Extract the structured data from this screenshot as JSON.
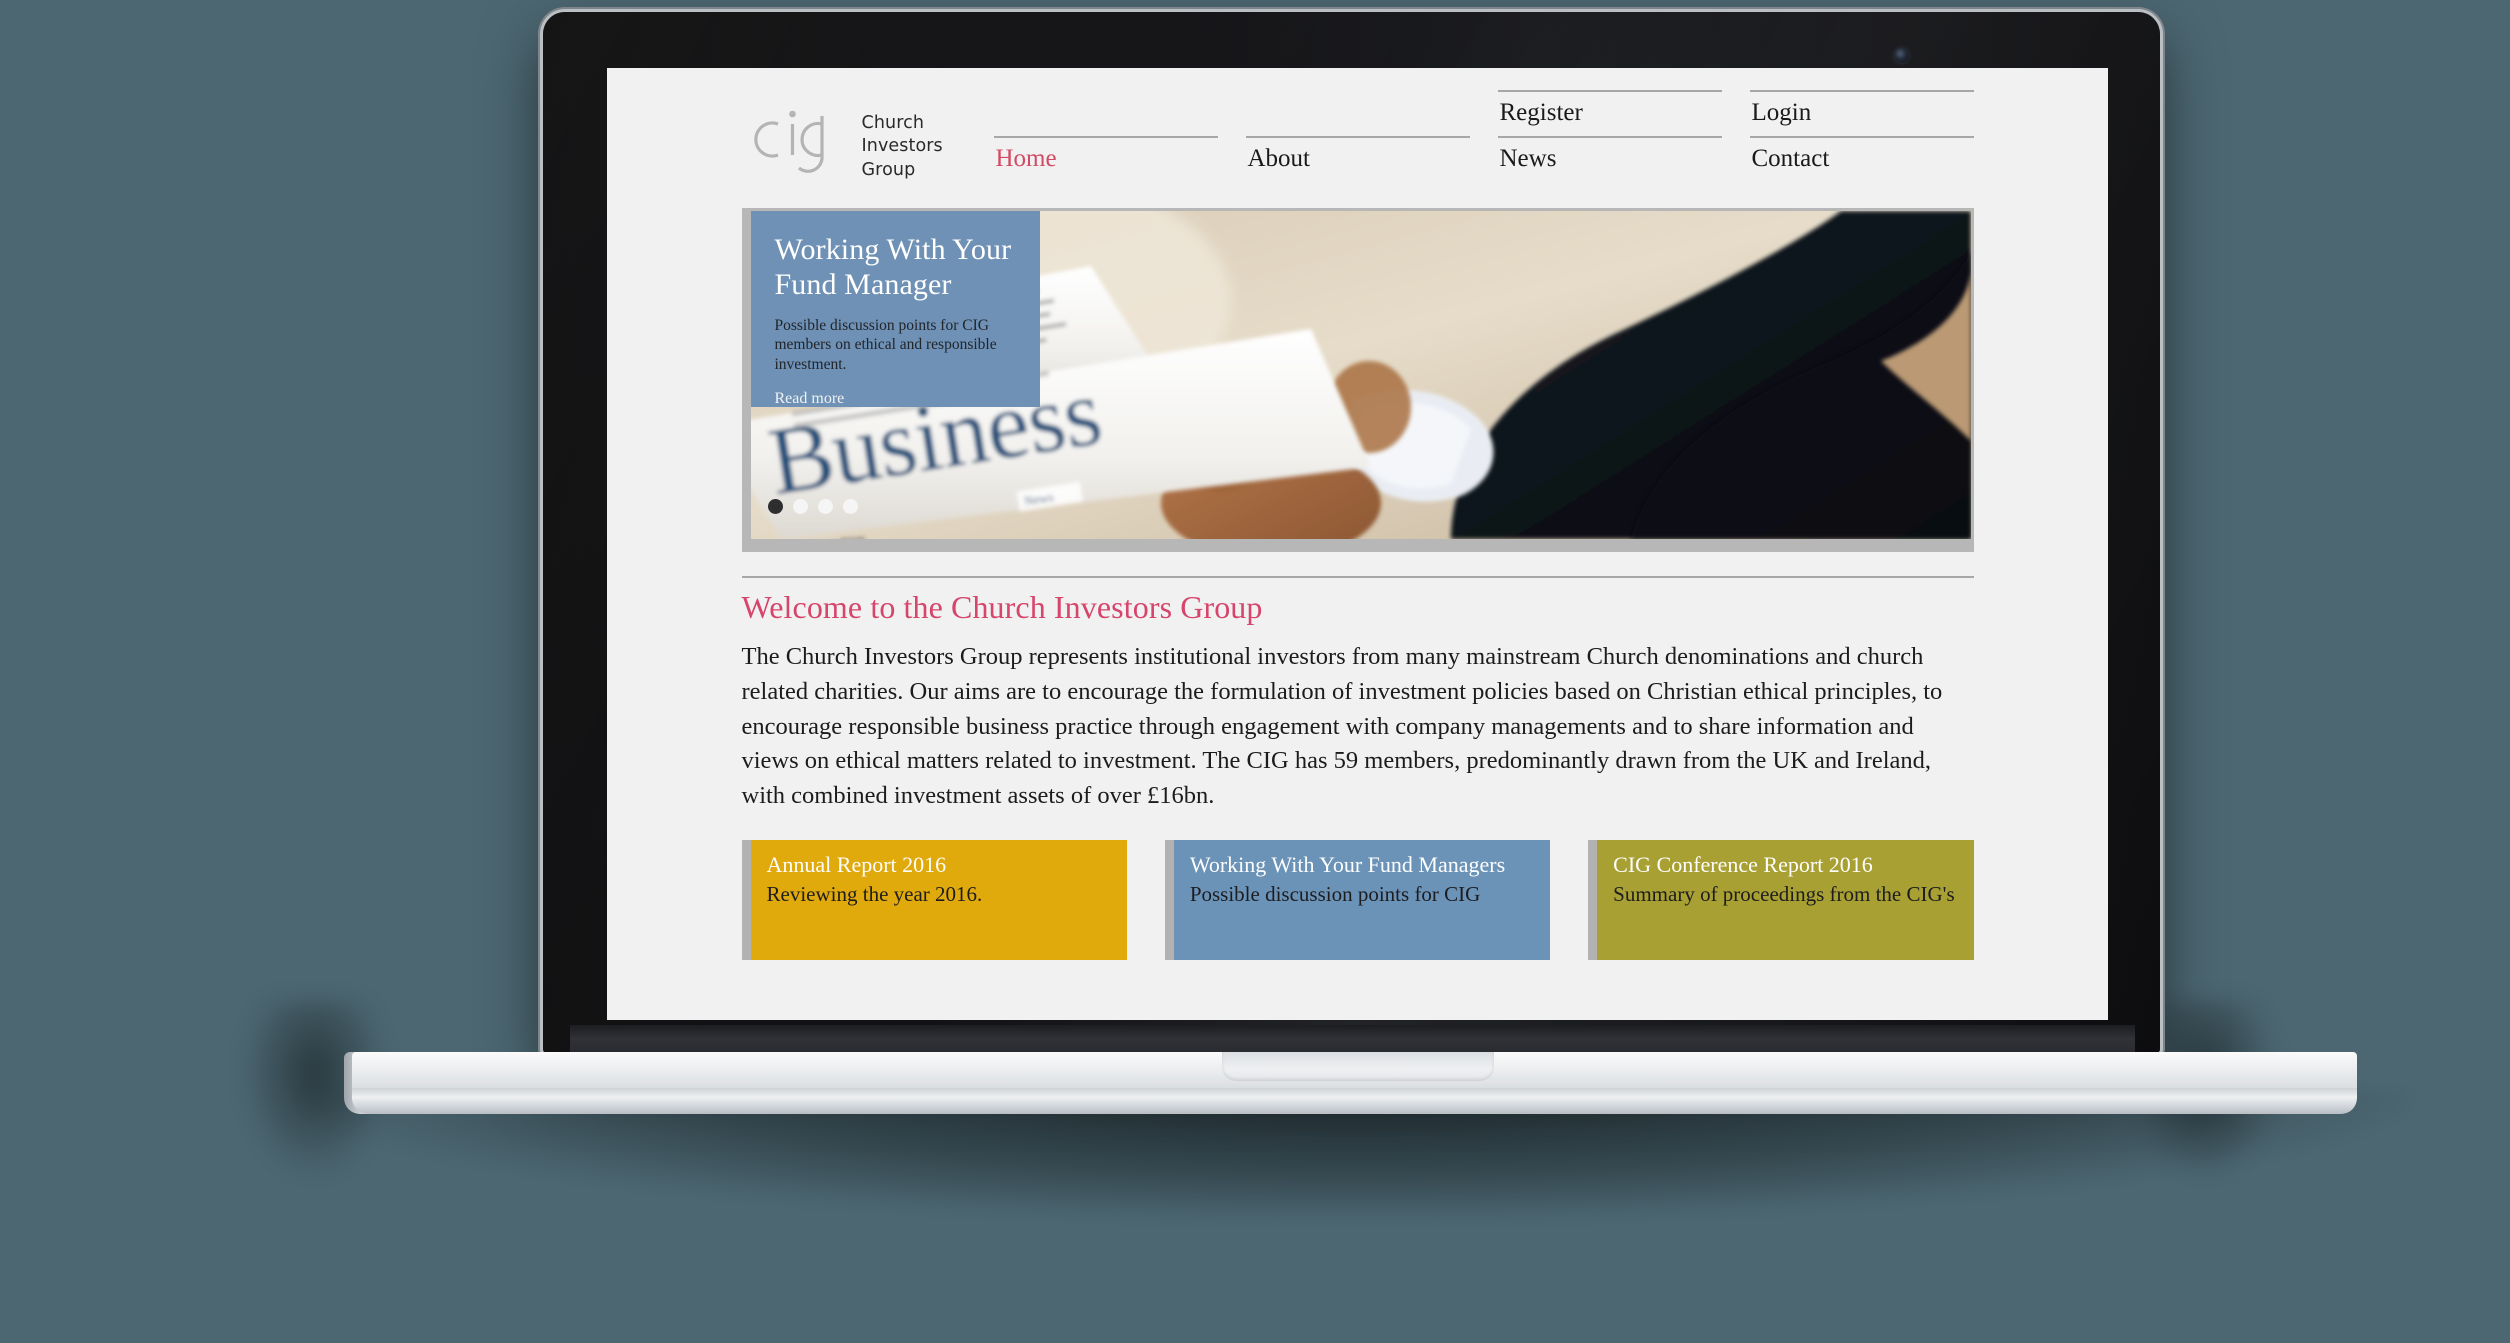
{
  "device": {
    "kind": "laptop-mockup",
    "backdrop_color": "#4c6772"
  },
  "site": {
    "brand": {
      "logo_text": "cig",
      "name_line1": "Church",
      "name_line2": "Investors",
      "name_line3": "Group"
    },
    "nav": {
      "top_row": [
        {
          "label": "",
          "href": "",
          "has_rule": false
        },
        {
          "label": "",
          "href": "",
          "has_rule": false
        },
        {
          "label": "Register",
          "has_rule": true
        },
        {
          "label": "Login",
          "has_rule": true
        }
      ],
      "bottom_row": [
        {
          "label": "Home",
          "active": true
        },
        {
          "label": "About",
          "active": false
        },
        {
          "label": "News",
          "active": false
        },
        {
          "label": "Contact",
          "active": false
        }
      ],
      "active_color": "#d24a63"
    },
    "hero": {
      "title": "Working With Your Fund Manager",
      "subtitle": "Possible discussion points for CIG members on ethical and responsible investment.",
      "read_more": "Read more",
      "overlay_color": "#6e91b5",
      "image_alt": "Man in dark suit reading a Business newspaper",
      "newspaper_masthead": "Business",
      "slides": 4,
      "active_slide": 1
    },
    "welcome": {
      "heading": "Welcome to the Church Investors Group",
      "heading_color": "#d6456b",
      "body": "The Church Investors Group represents institutional investors from many mainstream Church denominations and church related charities. Our aims are to encourage the formulation of investment policies based on Christian ethical principles, to encourage responsible business practice through engagement with company managements and to share information and views on ethical matters related to investment. The CIG has 59 members, predominantly drawn from the UK and Ireland, with combined investment assets of over £16bn."
    },
    "promos": [
      {
        "title": "Annual Report 2016",
        "desc": "Reviewing the year 2016.",
        "color": "#e0a90c"
      },
      {
        "title": "Working With Your Fund Managers",
        "desc": "Possible discussion points for CIG",
        "color": "#6b93b8"
      },
      {
        "title": "CIG Conference Report 2016",
        "desc": "Summary of proceedings from the CIG's",
        "color": "#a8a032"
      }
    ]
  }
}
